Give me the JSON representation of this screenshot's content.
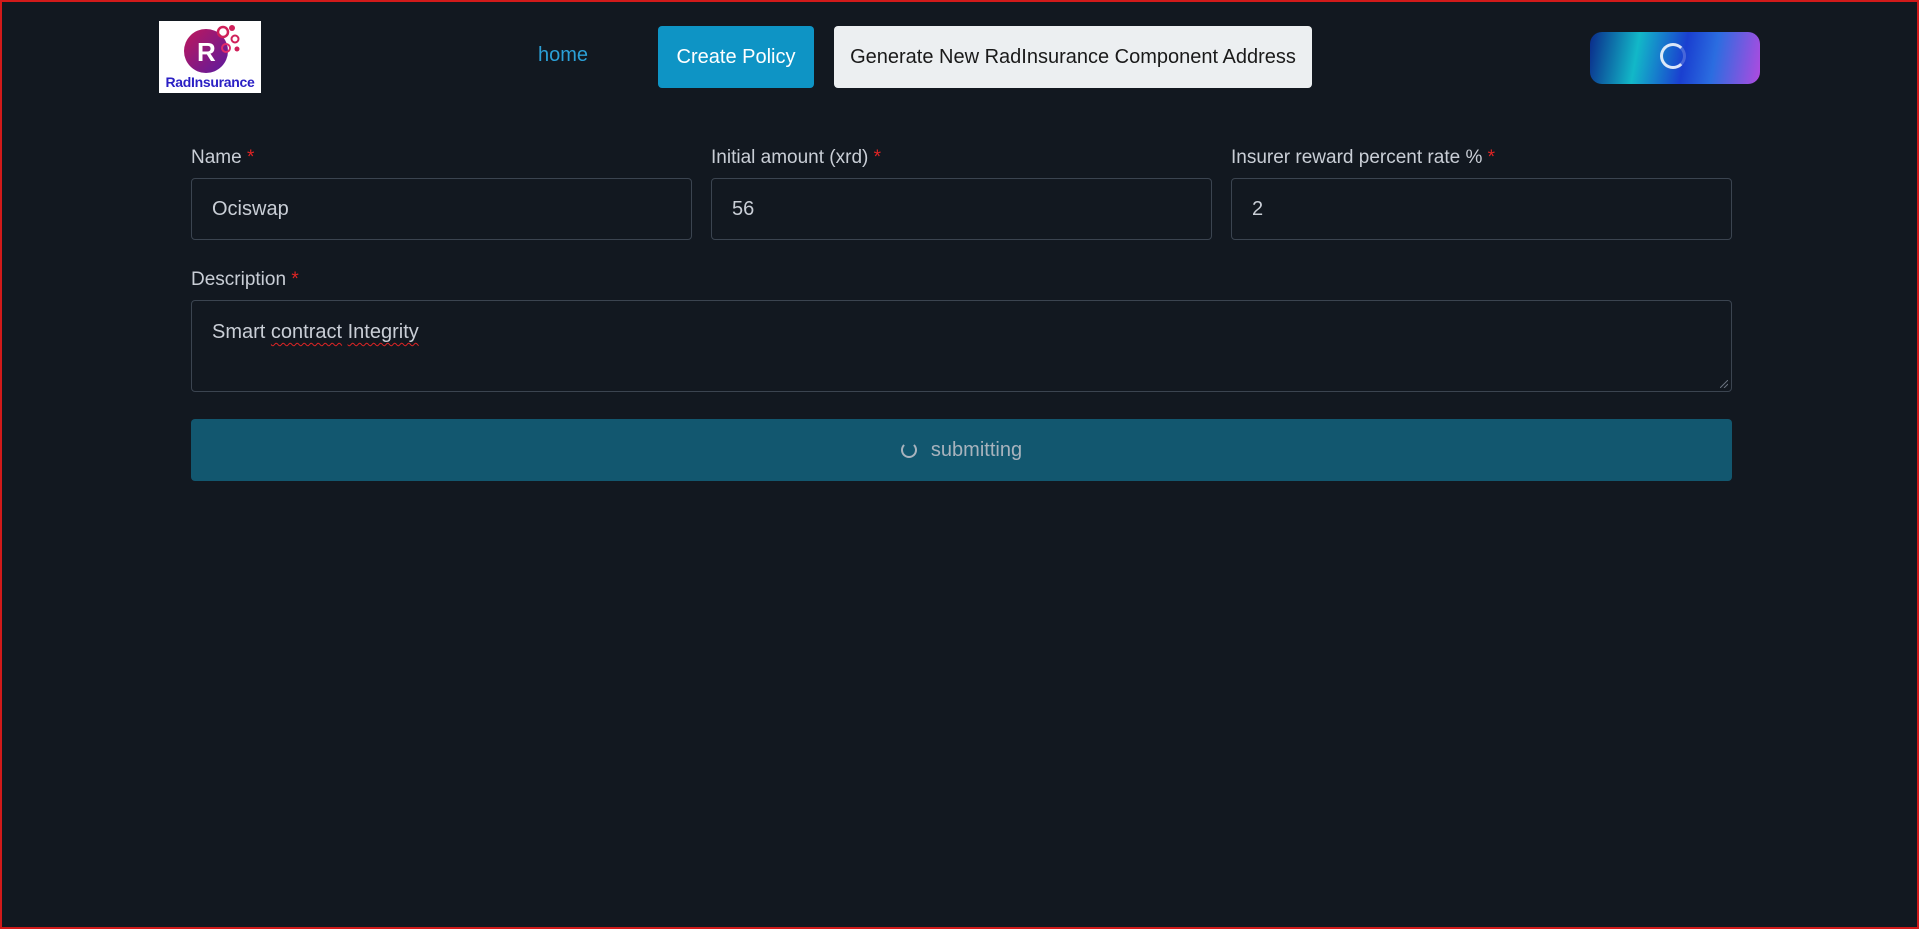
{
  "header": {
    "logo_text": "RadInsurance",
    "nav_home": "home",
    "create_policy_label": "Create Policy",
    "generate_label": "Generate New RadInsurance Component Address",
    "connect_button_state": "loading"
  },
  "form": {
    "name": {
      "label": "Name",
      "required_mark": "*",
      "value": "Ociswap"
    },
    "initial_amount": {
      "label": "Initial amount (xrd)",
      "required_mark": "*",
      "value": "56"
    },
    "reward_rate": {
      "label": "Insurer reward percent rate %",
      "required_mark": "*",
      "value": "2"
    },
    "description": {
      "label": "Description",
      "required_mark": "*",
      "value_parts": [
        "Smart",
        "contract",
        "Integrity"
      ]
    },
    "submit_label": "submitting"
  },
  "colors": {
    "background": "#121820",
    "accent": "#0e94c5",
    "link": "#2b9fd6",
    "submit_disabled": "#12576f",
    "required": "#e02424"
  }
}
